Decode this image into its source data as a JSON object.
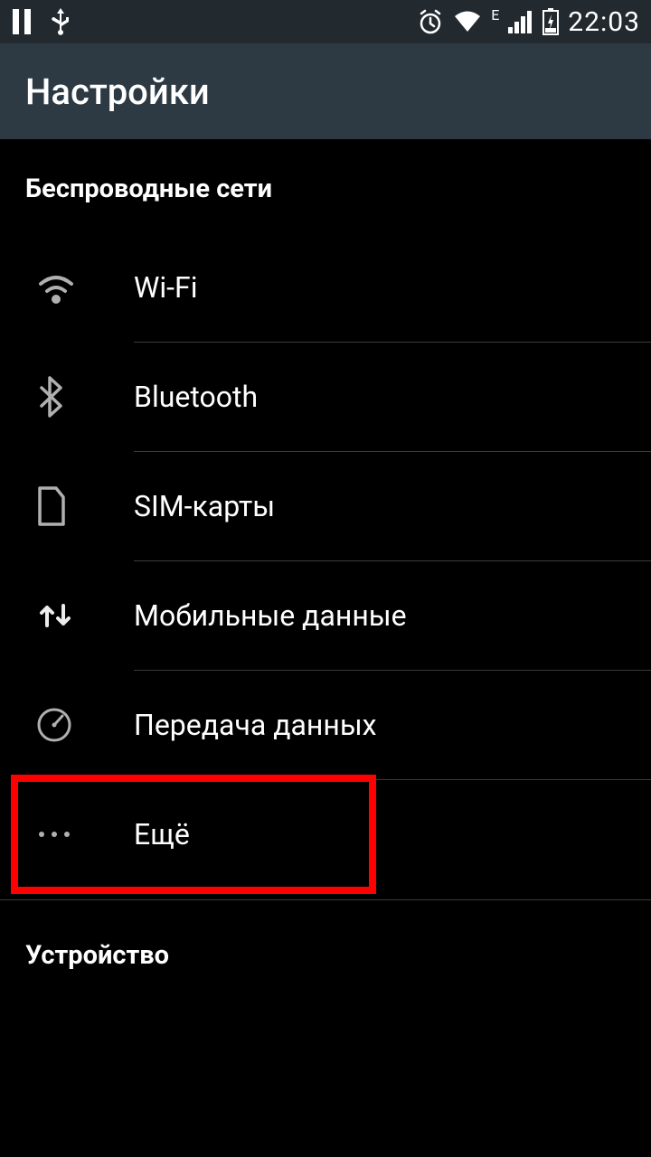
{
  "status_bar": {
    "network_indicator": "E",
    "time": "22:03"
  },
  "app_bar": {
    "title": "Настройки"
  },
  "sections": {
    "wireless": {
      "header": "Беспроводные сети",
      "items": [
        {
          "label": "Wi-Fi"
        },
        {
          "label": "Bluetooth"
        },
        {
          "label": "SIM-карты"
        },
        {
          "label": "Мобильные данные"
        },
        {
          "label": "Передача данных"
        },
        {
          "label": "Ещё"
        }
      ]
    },
    "device": {
      "header": "Устройство"
    }
  }
}
